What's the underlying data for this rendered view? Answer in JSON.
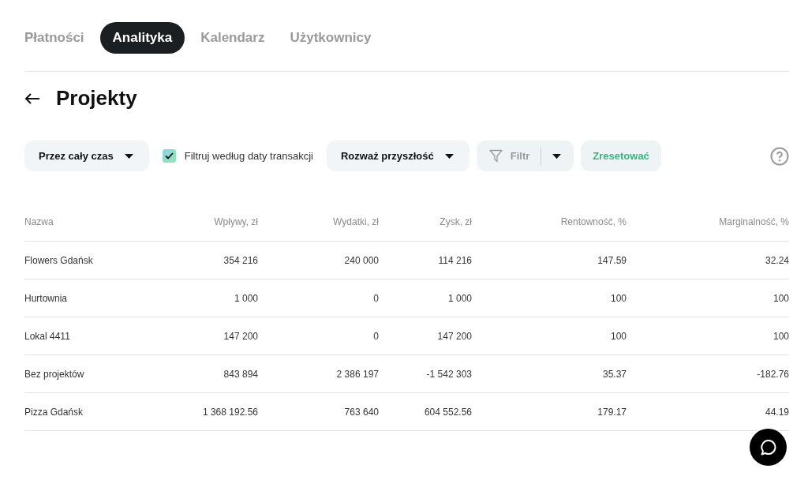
{
  "tabs": [
    {
      "label": "Płatności",
      "selected": false
    },
    {
      "label": "Analityka",
      "selected": true
    },
    {
      "label": "Kalendarz",
      "selected": false
    },
    {
      "label": "Użytkownicy",
      "selected": false
    }
  ],
  "page": {
    "title": "Projekty"
  },
  "toolbar": {
    "period_dropdown": {
      "label": "Przez cały czas"
    },
    "date_filter_checkbox": {
      "label": "Filtruj według daty transakcji",
      "checked": true
    },
    "future_dropdown": {
      "label": "Rozważ przyszłość"
    },
    "filter_button": {
      "label": "Filtr",
      "disabled": true
    },
    "reset_button": {
      "label": "Zresetować"
    }
  },
  "table": {
    "columns": [
      "Nazwa",
      "Wpływy, zł",
      "Wydatki, zł",
      "Zysk, zł",
      "Rentowność, %",
      "Marginalność, %"
    ],
    "rows": [
      [
        "Flowers Gdańsk",
        "354 216",
        "240 000",
        "114 216",
        "147.59",
        "32.24"
      ],
      [
        "Hurtownia",
        "1 000",
        "0",
        "1 000",
        "100",
        "100"
      ],
      [
        "Lokal 4411",
        "147 200",
        "0",
        "147 200",
        "100",
        "100"
      ],
      [
        "Bez projektów",
        "843 894",
        "2 386 197",
        "-1 542 303",
        "35.37",
        "-182.76"
      ],
      [
        "Pizza Gdańsk",
        "1 368 192.56",
        "763 640",
        "604 552.56",
        "179.17",
        "44.19"
      ]
    ]
  }
}
